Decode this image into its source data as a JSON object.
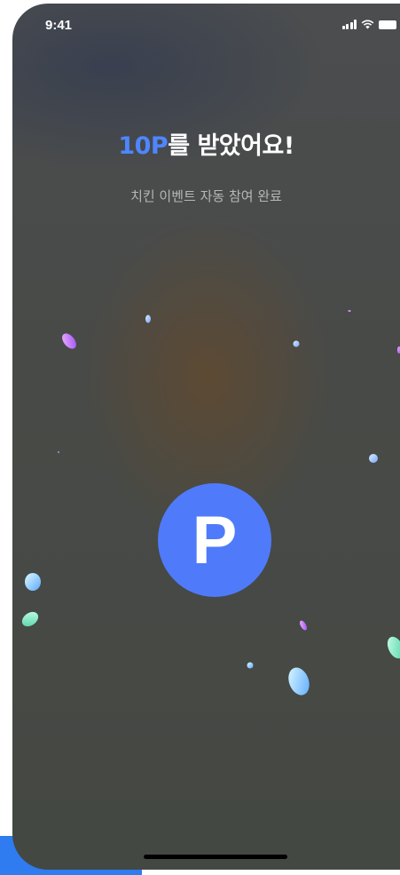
{
  "status_bar": {
    "time": "9:41"
  },
  "reward": {
    "title_highlight": "10P",
    "title_rest": "를 받았어요!",
    "subtitle": "치킨 이벤트 자동 참여 완료",
    "badge_letter": "P"
  },
  "icons": [
    "signal-icon",
    "wifi-icon",
    "battery-icon"
  ],
  "colors": {
    "accent": "#4e86ff",
    "badge": "#4f7bfb",
    "background": "#474a47",
    "bottom_button": "#2f7bf0"
  }
}
